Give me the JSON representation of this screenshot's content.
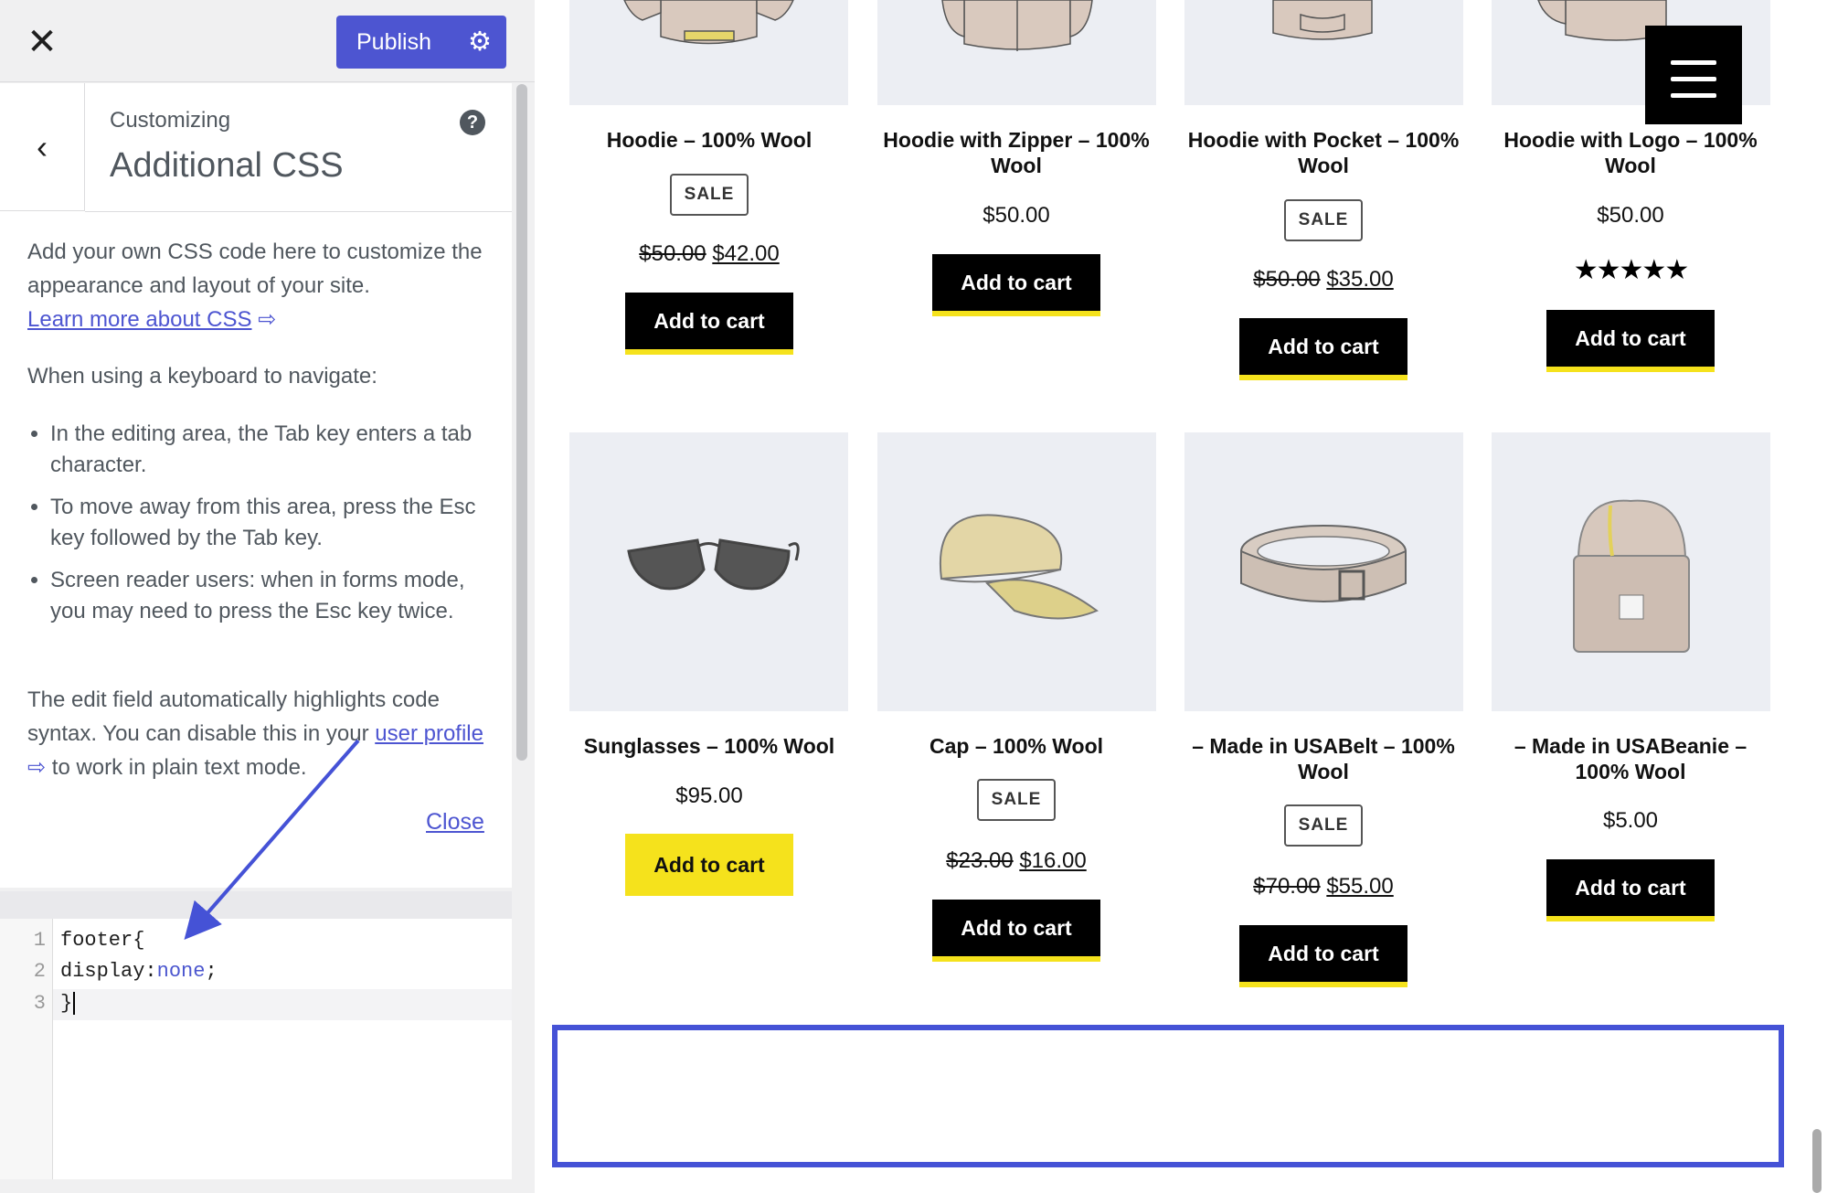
{
  "customizer": {
    "close_icon": "close-icon",
    "publish_label": "Publish",
    "settings_icon": "gear-icon",
    "back_icon": "chevron-left-icon",
    "crumb": "Customizing",
    "title": "Additional CSS",
    "help_icon": "help-icon",
    "help_glyph": "?",
    "description": {
      "intro": "Add your own CSS code here to customize the appearance and layout of your site.",
      "learn_more_link": "Learn more about CSS",
      "keyboard_intro": "When using a keyboard to navigate:",
      "tips": [
        "In the editing area, the Tab key enters a tab character.",
        "To move away from this area, press the Esc key followed by the Tab key.",
        "Screen reader users: when in forms mode, you may need to press the Esc key twice."
      ],
      "highlight_part1": "The edit field automatically highlights code syntax. You can disable this in your",
      "user_profile_link": "user profile",
      "highlight_part2": "to work in plain text mode.",
      "close_link": "Close",
      "external_link_icon": "external-link-icon"
    },
    "editor": {
      "line_numbers": [
        "1",
        "2",
        "3"
      ],
      "code": {
        "line1": "footer{",
        "line2_prop": "display:",
        "line2_value": "none",
        "line2_end": ";",
        "line3": "}"
      }
    }
  },
  "store": {
    "menu_icon": "hamburger-menu-icon",
    "sale_badge": "SALE",
    "add_to_cart": "Add to cart",
    "products": [
      {
        "title": "Hoodie – 100% Wool",
        "sale": true,
        "old_price": "$50.00",
        "price": "$42.00",
        "image": "hoodie"
      },
      {
        "title": "Hoodie with Zipper – 100% Wool",
        "sale": false,
        "price": "$50.00",
        "image": "hoodie-zipper"
      },
      {
        "title": "Hoodie with Pocket – 100% Wool",
        "sale": true,
        "old_price": "$50.00",
        "price": "$35.00",
        "image": "hoodie-pocket"
      },
      {
        "title": "Hoodie with Logo – 100% Wool",
        "sale": false,
        "price": "$50.00",
        "rating": 5,
        "rating_stars": "★★★★★",
        "image": "hoodie-logo"
      },
      {
        "title": "Sunglasses – 100% Wool",
        "sale": false,
        "price": "$95.00",
        "image": "sunglasses"
      },
      {
        "title": "Cap – 100% Wool",
        "sale": true,
        "old_price": "$23.00",
        "price": "$16.00",
        "image": "cap"
      },
      {
        "title": "– Made in USABelt – 100% Wool",
        "sale": true,
        "old_price": "$70.00",
        "price": "$55.00",
        "image": "belt"
      },
      {
        "title": "– Made in USABeanie – 100% Wool",
        "sale": false,
        "price": "$5.00",
        "image": "beanie"
      }
    ]
  },
  "colors": {
    "accent": "#4d55d1",
    "cart_underline": "#f5e21c",
    "highlight_box": "#4552d6"
  }
}
